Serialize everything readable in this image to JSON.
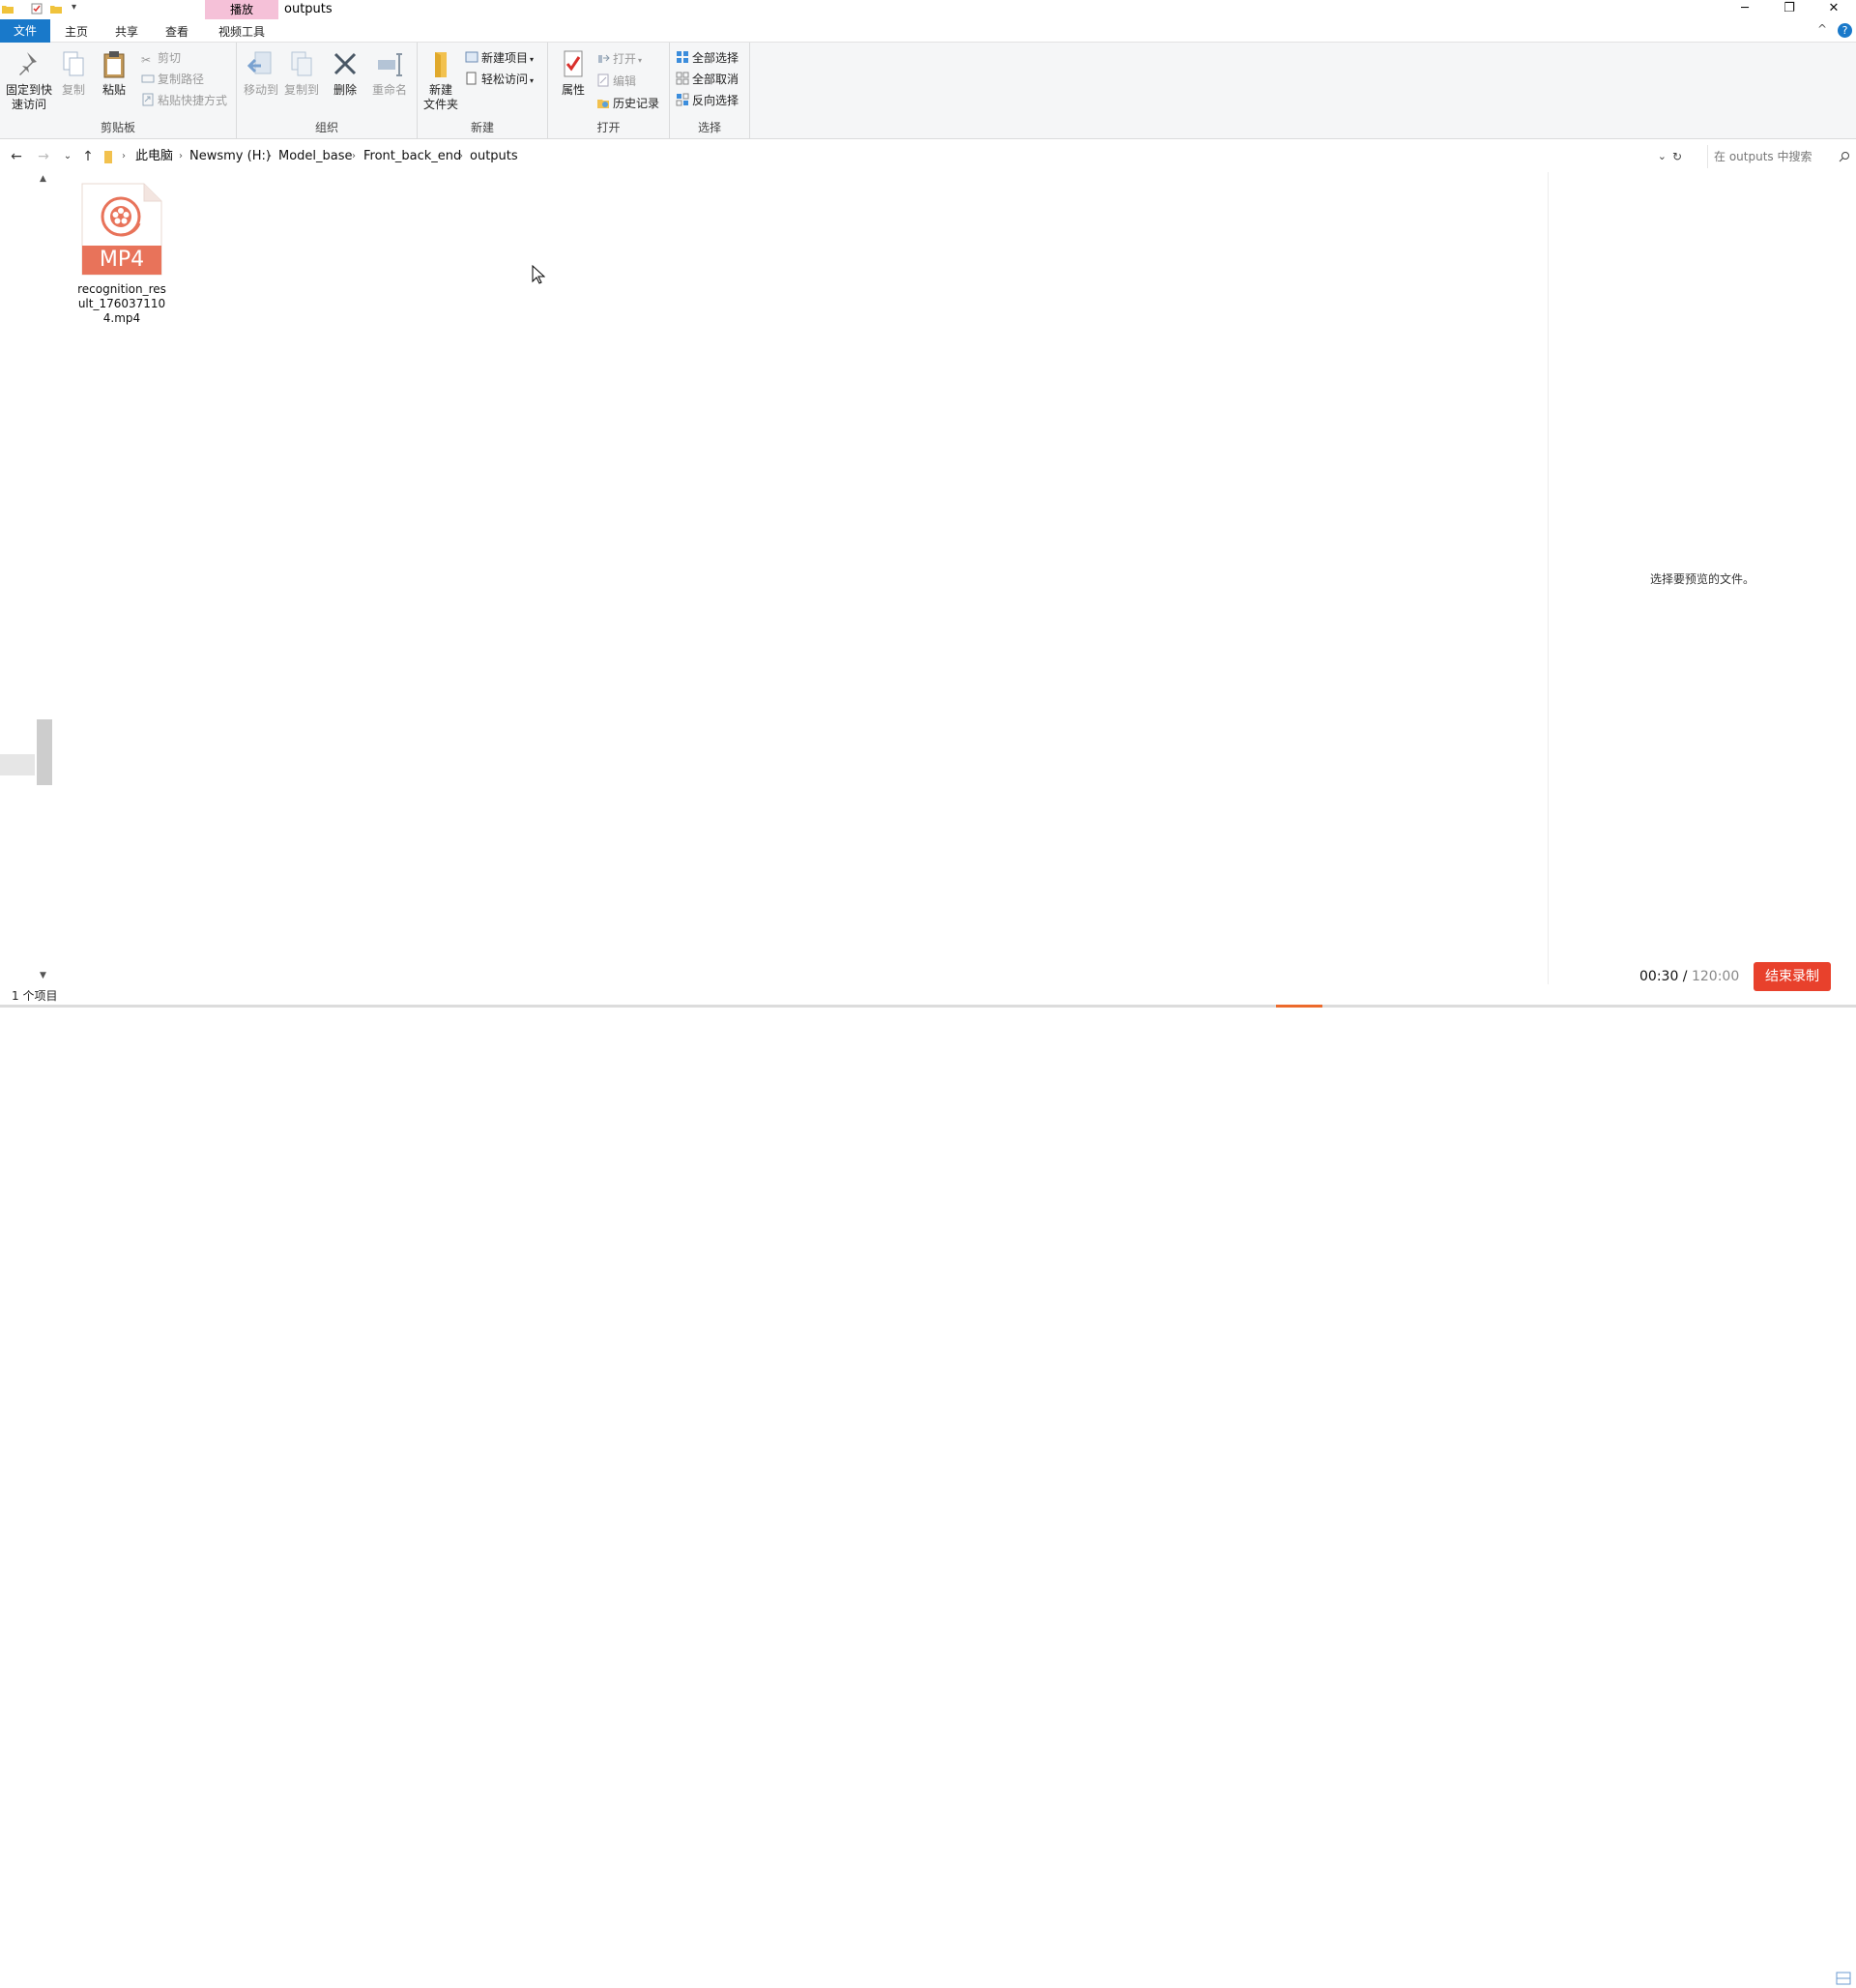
{
  "titlebar": {
    "context_tab": "播放",
    "window_title": "outputs",
    "minimize": "─",
    "restore": "❐",
    "close": "✕"
  },
  "tabs": {
    "file": "文件",
    "home": "主页",
    "share": "共享",
    "view": "查看",
    "video_tools": "视频工具",
    "collapse": "^",
    "help": "?"
  },
  "ribbon": {
    "clipboard": {
      "label": "剪贴板",
      "pin_line1": "固定到快",
      "pin_line2": "速访问",
      "copy": "复制",
      "paste": "粘贴",
      "cut": "剪切",
      "copy_path": "复制路径",
      "paste_shortcut": "粘贴快捷方式"
    },
    "organize": {
      "label": "组织",
      "move_to": "移动到",
      "copy_to": "复制到",
      "delete": "删除",
      "rename": "重命名"
    },
    "new": {
      "label": "新建",
      "new_folder_line1": "新建",
      "new_folder_line2": "文件夹",
      "new_item": "新建项目",
      "easy_access": "轻松访问"
    },
    "open": {
      "label": "打开",
      "properties": "属性",
      "open": "打开",
      "edit": "编辑",
      "history": "历史记录"
    },
    "select": {
      "label": "选择",
      "select_all": "全部选择",
      "select_none": "全部取消",
      "invert": "反向选择"
    }
  },
  "address": {
    "crumbs": [
      "此电脑",
      "Newsmy (H:)",
      "Model_base",
      "Front_back_end",
      "outputs"
    ],
    "search_placeholder": "在 outputs 中搜索"
  },
  "file": {
    "badge": "MP4",
    "name": "recognition_result_1760371104.mp4"
  },
  "preview": {
    "message": "选择要预览的文件。"
  },
  "status": {
    "count": "1 个项目"
  },
  "recorder": {
    "elapsed": "00:30",
    "separator": " / ",
    "total": "120:00",
    "stop_label": "结束录制"
  },
  "colors": {
    "accent": "#1979ca",
    "context_tab": "#f5c1d8",
    "mp4_icon": "#e8735a",
    "record_button": "#e8412c"
  }
}
